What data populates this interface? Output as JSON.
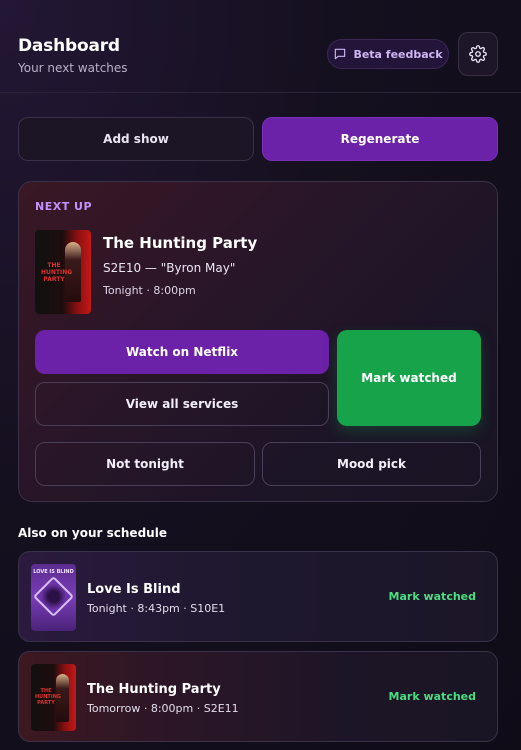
{
  "header": {
    "title": "Dashboard",
    "subtitle": "Your next watches",
    "beta_label": "Beta feedback"
  },
  "actions": {
    "add_show": "Add show",
    "regenerate": "Regenerate"
  },
  "next_up": {
    "section_label": "NEXT UP",
    "poster_text": "THE HUNTING PARTY",
    "title": "The Hunting Party",
    "episode": "S2E10 — \"Byron May\"",
    "airtime": "Tonight · 8:00pm",
    "watch_label": "Watch on Netflix",
    "view_services_label": "View all services",
    "mark_watched_label": "Mark watched",
    "not_tonight_label": "Not tonight",
    "mood_pick_label": "Mood pick"
  },
  "schedule": {
    "heading": "Also on your schedule",
    "items": [
      {
        "poster_text": "LOVE IS BLIND",
        "title": "Love Is Blind",
        "meta": "Tonight · 8:43pm · S10E1",
        "action": "Mark watched"
      },
      {
        "poster_text": "THE HUNTING PARTY",
        "title": "The Hunting Party",
        "meta": "Tomorrow · 8:00pm · S2E11",
        "action": "Mark watched"
      }
    ]
  },
  "colors": {
    "accent_purple": "#6b21a8",
    "success_green": "#16a34a",
    "success_text": "#4ade80",
    "label_purple": "#c590ff"
  }
}
